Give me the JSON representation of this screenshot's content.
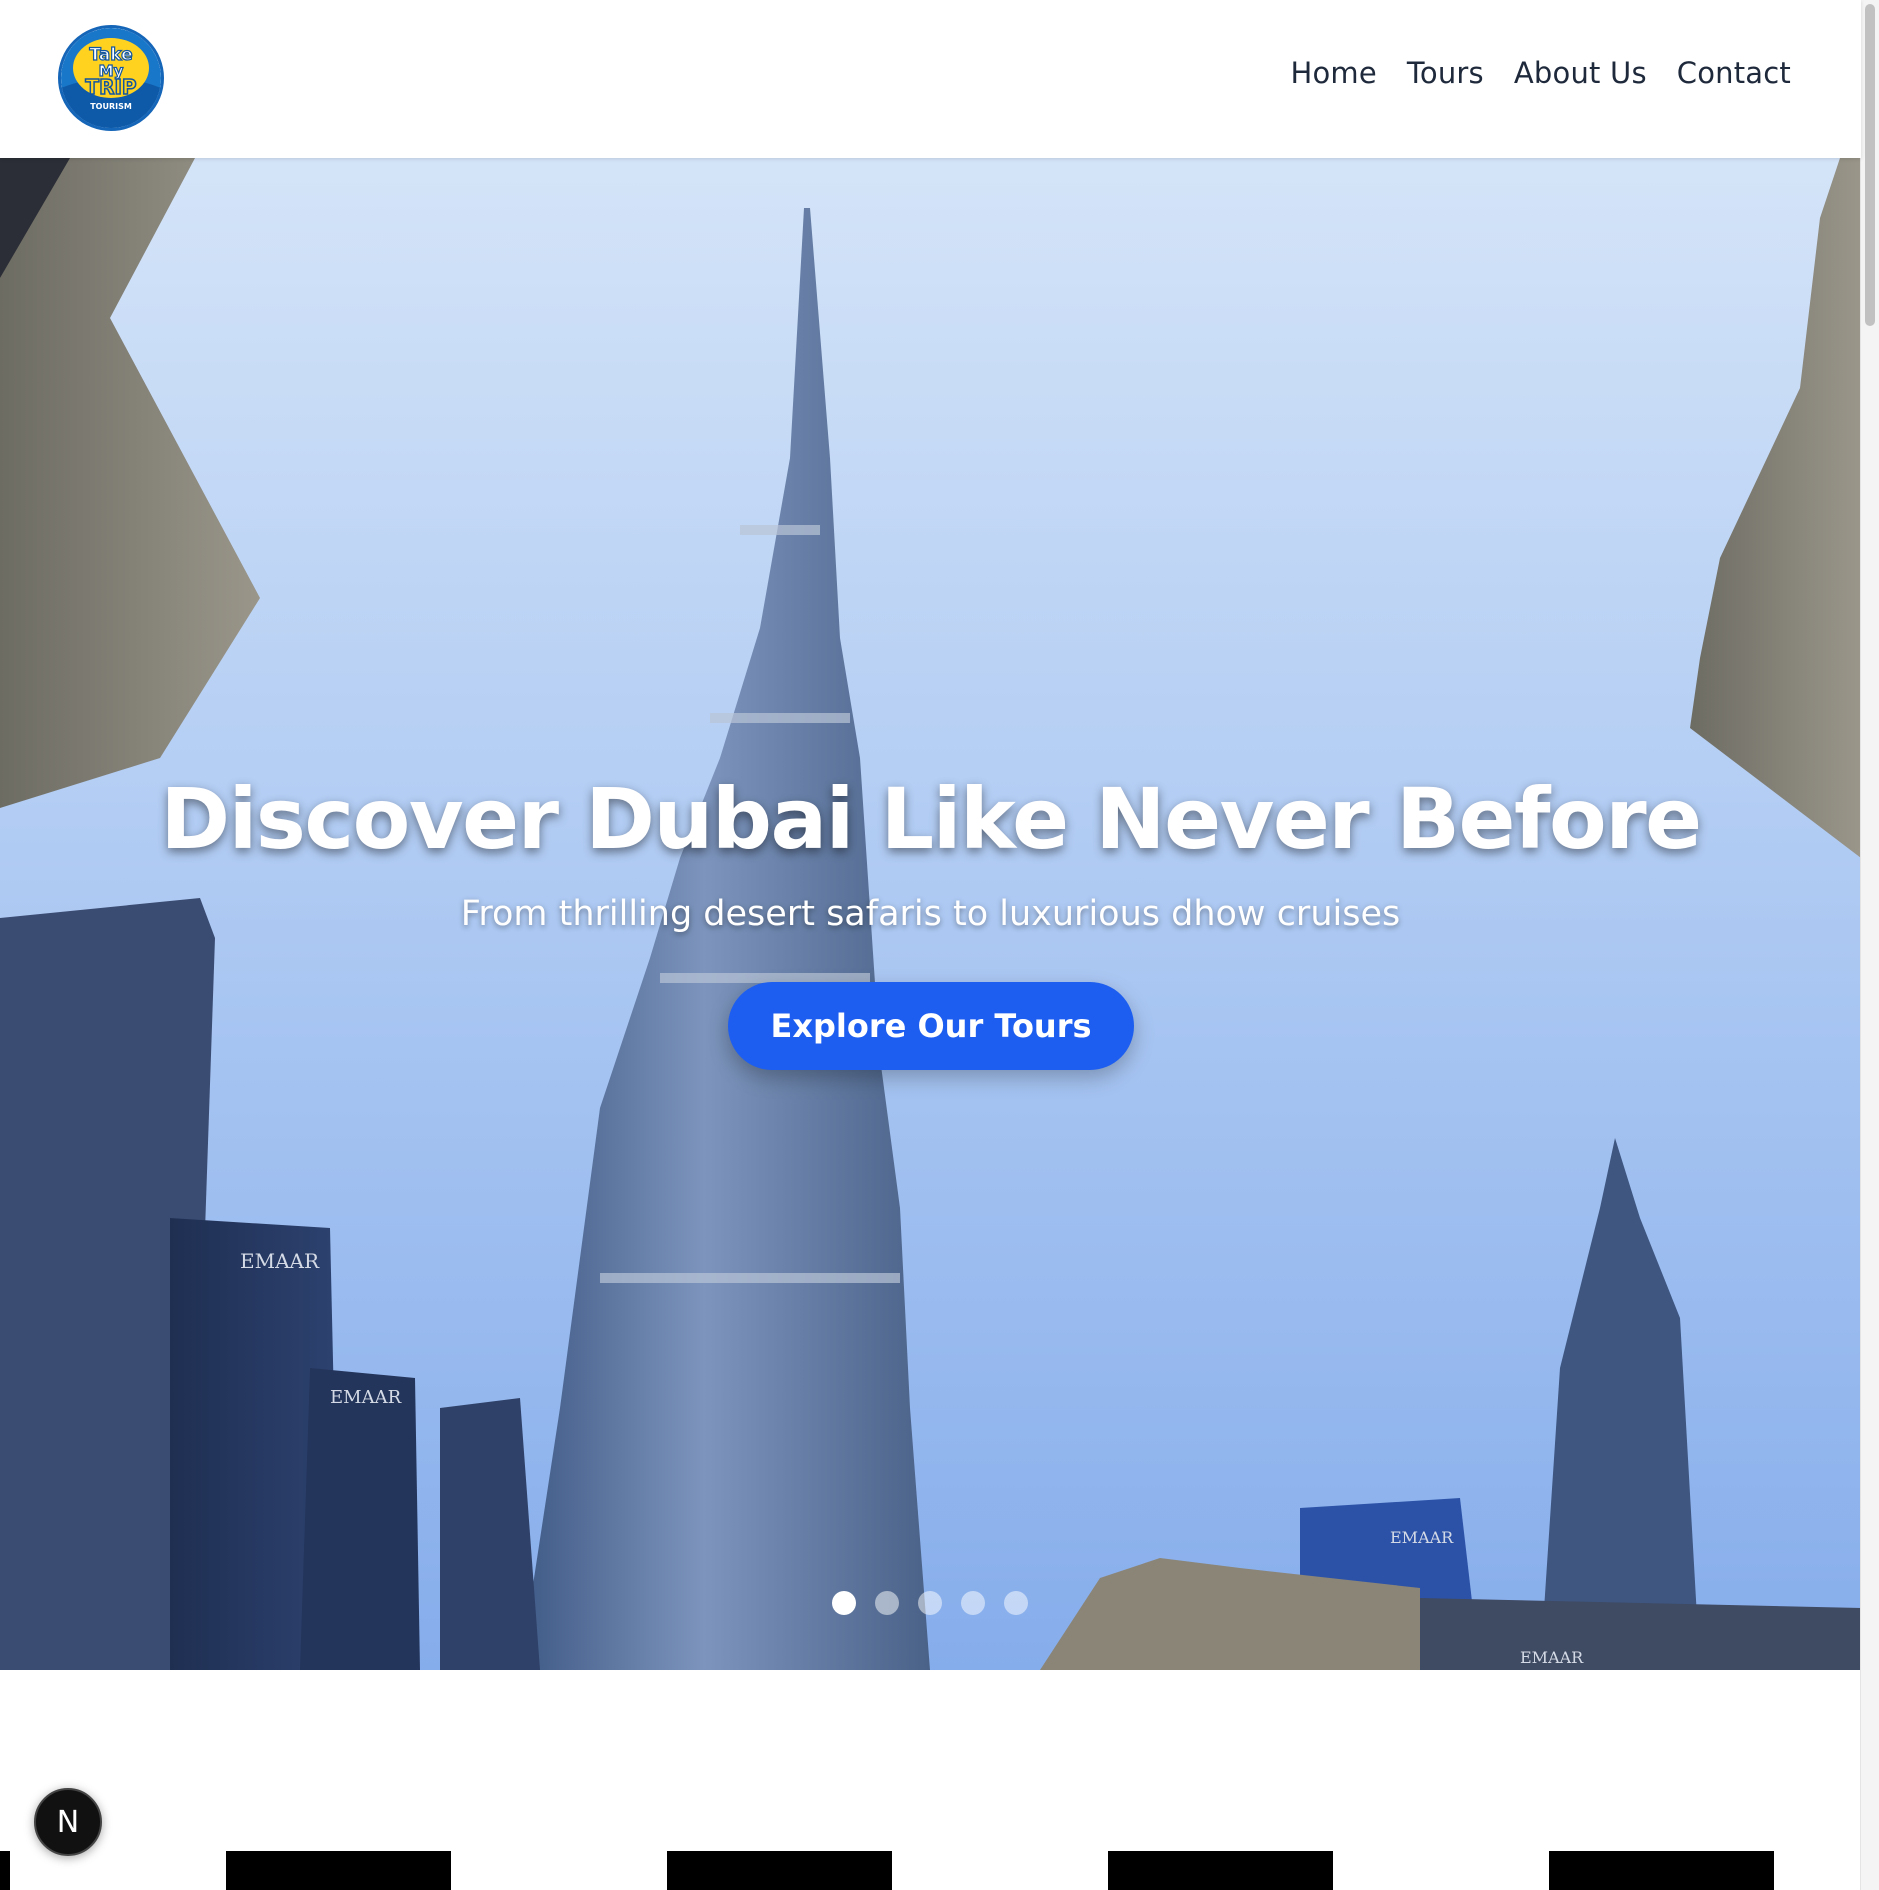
{
  "brand": {
    "logo_line1": "Take",
    "logo_line2": "My",
    "logo_line3": "TRIP",
    "logo_line4": "TOURISM"
  },
  "nav": {
    "items": [
      {
        "label": "Home"
      },
      {
        "label": "Tours"
      },
      {
        "label": "About Us"
      },
      {
        "label": "Contact"
      }
    ]
  },
  "hero": {
    "title": "Discover Dubai Like Never Before",
    "subtitle": "From thrilling desert safaris to luxurious dhow cruises",
    "cta_label": "Explore Our Tours",
    "slide_count": 5,
    "active_slide": 1,
    "building_signs": [
      "EMAAR",
      "EMAAR",
      "EMAAR",
      "EMAAR"
    ]
  },
  "dev_badge": {
    "icon": "nextjs-icon",
    "glyph": "N"
  },
  "colors": {
    "accent": "#1d5ef0",
    "nav_text": "#1e293b",
    "sky_top": "#cfe0f7",
    "sky_bottom": "#8fb4ee"
  }
}
